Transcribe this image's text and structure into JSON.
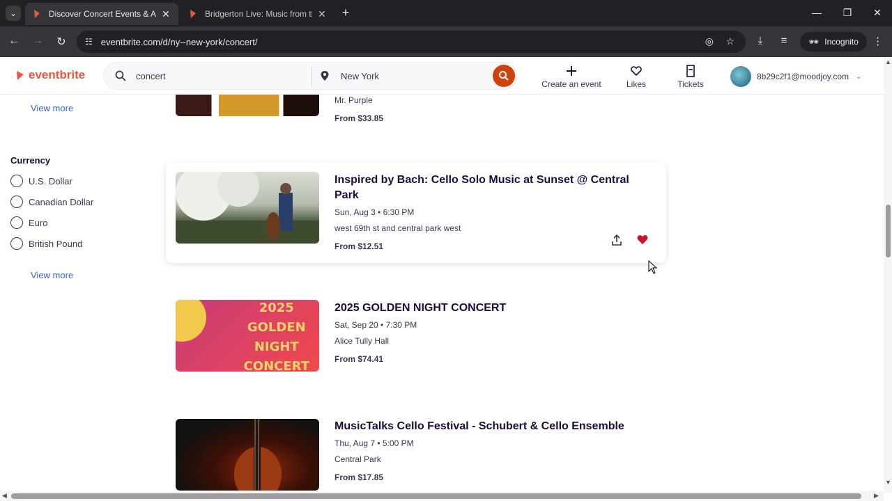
{
  "browser": {
    "tabs": [
      {
        "title": "Discover Concert Events & Acti",
        "active": true
      },
      {
        "title": "Bridgerton Live: Music from the",
        "active": false
      }
    ],
    "url": "eventbrite.com/d/ny--new-york/concert/",
    "incognito_label": "Incognito"
  },
  "header": {
    "logo": "eventbrite",
    "search_query": "concert",
    "location": "New York",
    "nav": [
      {
        "label": "Create an event",
        "icon": "plus-icon"
      },
      {
        "label": "Likes",
        "icon": "heart-icon"
      },
      {
        "label": "Tickets",
        "icon": "ticket-icon"
      }
    ],
    "account_email": "8b29c2f1@moodjoy.com"
  },
  "filters": {
    "view_more_top": "View more",
    "currency_title": "Currency",
    "currency_options": [
      "U.S. Dollar",
      "Canadian Dollar",
      "Euro",
      "British Pound"
    ],
    "view_more_bottom": "View more"
  },
  "events": [
    {
      "title": "",
      "organizer": "Mr. Purple",
      "price": "From $33.85"
    },
    {
      "title": "Inspired by Bach: Cello Solo Music at Sunset @ Central Park",
      "date": "Sun, Aug 3 • 6:30 PM",
      "location": "west 69th st and central park west",
      "price": "From $12.51",
      "liked": true
    },
    {
      "title": "2025 GOLDEN NIGHT CONCERT",
      "date": "Sat, Sep 20 • 7:30 PM",
      "location": "Alice Tully Hall",
      "price": "From $74.41",
      "image_text": [
        "2025",
        "GOLDEN",
        "NIGHT",
        "CONCERT"
      ]
    },
    {
      "title": "MusicTalks Cello Festival - Schubert & Cello Ensemble",
      "date": "Thu, Aug 7 • 5:00 PM",
      "location": "Central Park",
      "price": "From $17.85"
    }
  ],
  "colors": {
    "brand": "#f05537",
    "search_button": "#d1410c",
    "link": "#3659e3",
    "liked_heart": "#c5162e"
  }
}
